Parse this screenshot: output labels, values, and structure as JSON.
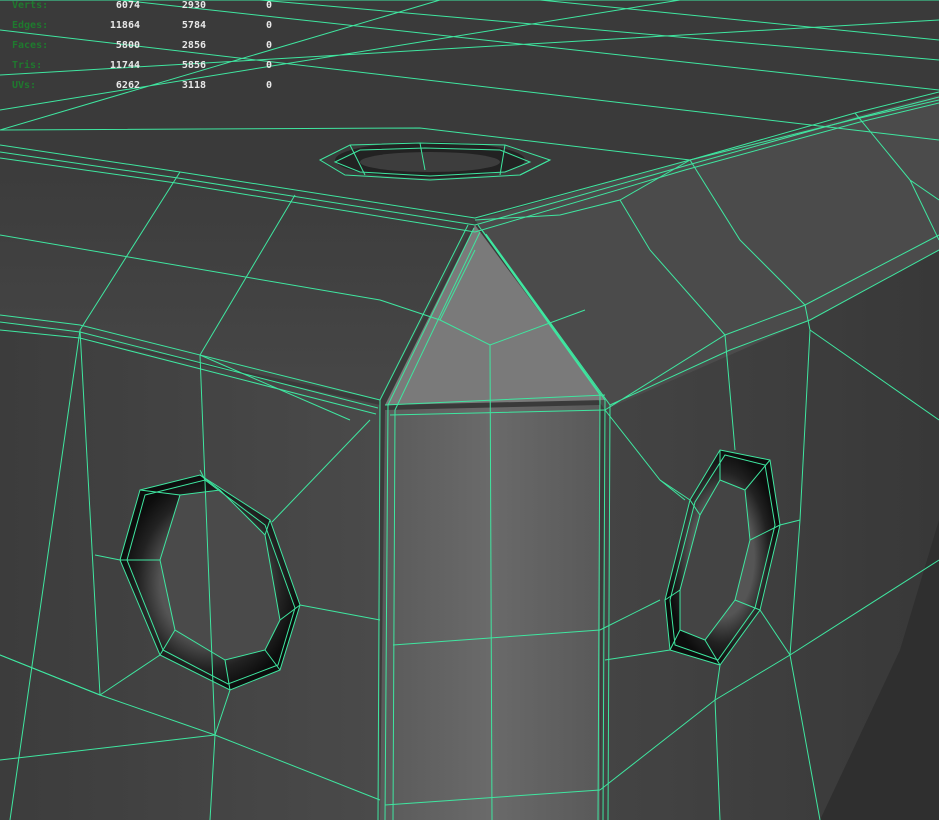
{
  "hud": {
    "rows": [
      {
        "label": "Verts:",
        "total": "6074",
        "selected": "2930",
        "extra": "0"
      },
      {
        "label": "Edges:",
        "total": "11864",
        "selected": "5784",
        "extra": "0"
      },
      {
        "label": "Faces:",
        "total": "5800",
        "selected": "2856",
        "extra": "0"
      },
      {
        "label": "Tris:",
        "total": "11744",
        "selected": "5856",
        "extra": "0"
      },
      {
        "label": "UVs:",
        "total": "6262",
        "selected": "3118",
        "extra": "0"
      }
    ]
  },
  "colors": {
    "wireframe": "#3fe6a0",
    "hud_label": "#1f7a2e",
    "hud_value": "#e8e8e8"
  }
}
